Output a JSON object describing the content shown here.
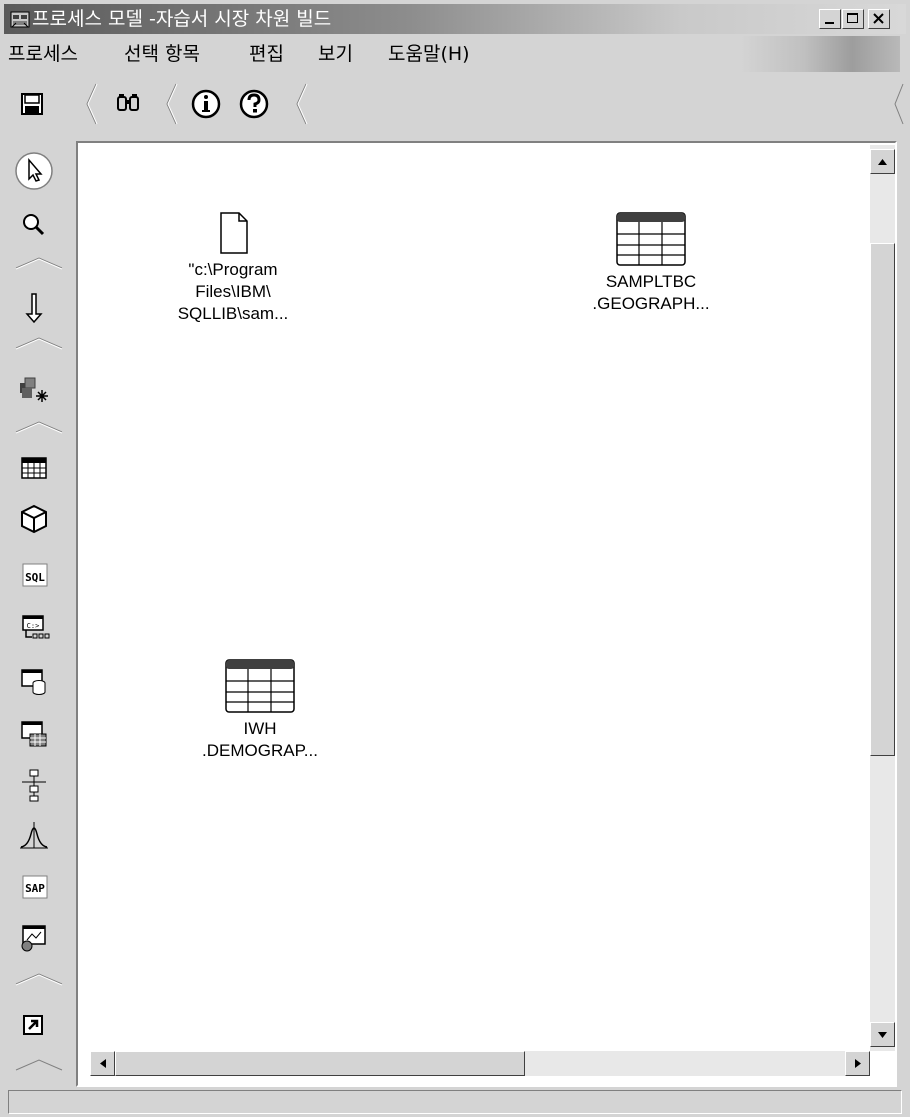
{
  "window": {
    "title": "프로세스 모델 -자습서 시장 차원 빌드",
    "minimize_icon": "minimize-icon",
    "maximize_icon": "maximize-icon",
    "close_icon": "close-icon"
  },
  "menu": {
    "items": [
      "프로세스",
      "선택 항목",
      "편집",
      "보기",
      "도움말(H)"
    ]
  },
  "toolbar": {
    "buttons": [
      {
        "name": "save",
        "icon": "floppy-disk-icon"
      },
      {
        "name": "find",
        "icon": "binoculars-icon"
      },
      {
        "name": "info",
        "icon": "info-icon"
      },
      {
        "name": "help",
        "icon": "question-icon"
      }
    ]
  },
  "palette": {
    "tools": [
      {
        "name": "select",
        "icon": "pointer-arrow-icon"
      },
      {
        "name": "zoom",
        "icon": "magnifier-icon"
      },
      {
        "name": "data-link",
        "icon": "down-arrow-icon"
      },
      {
        "name": "cascade-link",
        "icon": "cubes-star-icon"
      },
      {
        "name": "table",
        "icon": "table-grid-icon"
      },
      {
        "name": "cube",
        "icon": "cube-icon"
      },
      {
        "name": "sql",
        "icon": "sql-icon"
      },
      {
        "name": "command",
        "icon": "command-prompt-icon"
      },
      {
        "name": "file-export",
        "icon": "window-cylinder-icon"
      },
      {
        "name": "transformer",
        "icon": "window-table-icon"
      },
      {
        "name": "tree",
        "icon": "hierarchy-icon"
      },
      {
        "name": "statistics",
        "icon": "bell-curve-icon"
      },
      {
        "name": "sap",
        "icon": "sap-icon"
      },
      {
        "name": "web-traffic",
        "icon": "globe-window-icon"
      },
      {
        "name": "shortcut",
        "icon": "shortcut-arrow-icon"
      }
    ]
  },
  "canvas": {
    "nodes": [
      {
        "label": "\"c:\\Program\nFiles\\IBM\\\nSQLLIB\\sam...",
        "icon": "file-icon"
      },
      {
        "label": "SAMPLTBC\n.GEOGRAPH...",
        "icon": "table-icon"
      },
      {
        "label": "IWH\n.DEMOGRAP...",
        "icon": "table-icon"
      }
    ]
  },
  "status": {
    "text": ""
  }
}
